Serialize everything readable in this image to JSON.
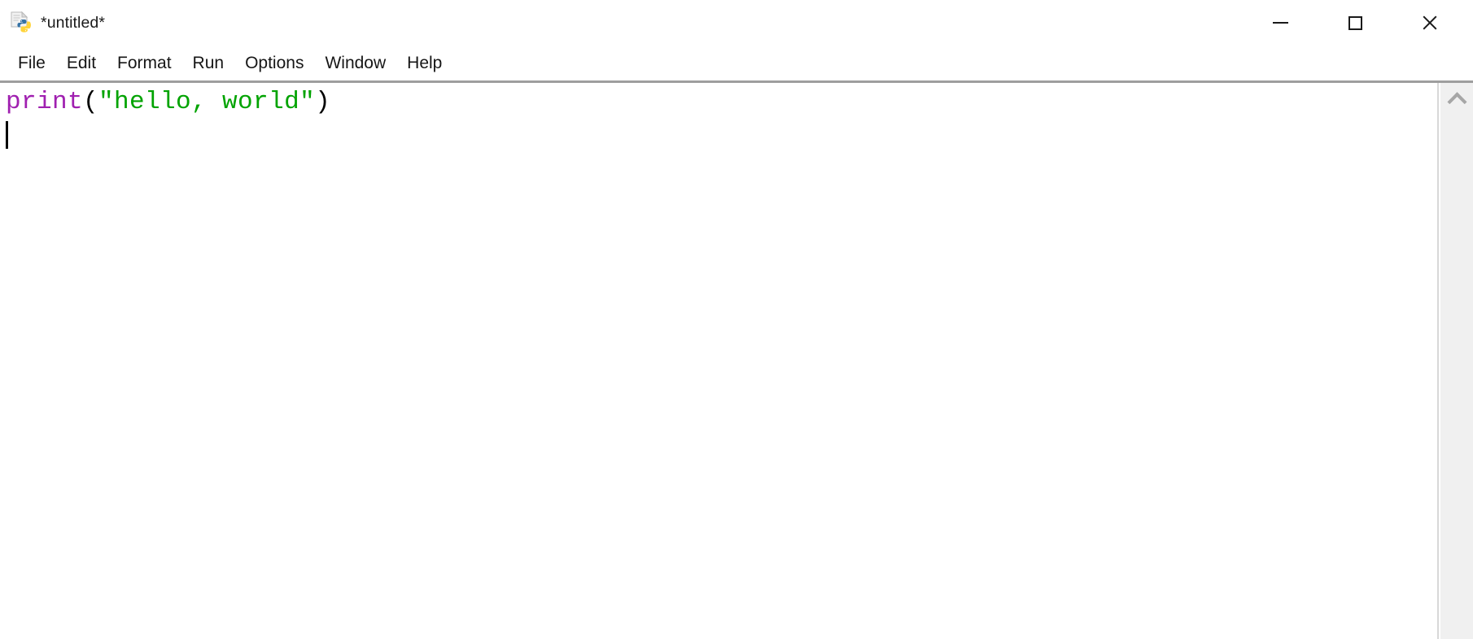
{
  "window": {
    "title": "*untitled*",
    "icon": "python-file-icon",
    "controls": {
      "minimize_label": "—",
      "maximize_label": "□",
      "close_label": "✕"
    }
  },
  "menubar": {
    "items": [
      {
        "label": "File"
      },
      {
        "label": "Edit"
      },
      {
        "label": "Format"
      },
      {
        "label": "Run"
      },
      {
        "label": "Options"
      },
      {
        "label": "Window"
      },
      {
        "label": "Help"
      }
    ]
  },
  "editor": {
    "lines": [
      {
        "tokens": [
          {
            "text": "print",
            "type": "builtin"
          },
          {
            "text": "(",
            "type": "punct"
          },
          {
            "text": "\"hello, world\"",
            "type": "string"
          },
          {
            "text": ")",
            "type": "punct"
          }
        ]
      },
      {
        "tokens": [],
        "caret": true
      }
    ],
    "full_text": "print(\"hello, world\")",
    "cursor_line": 2,
    "cursor_column": 1
  },
  "scrollbar": {
    "up_arrow": "chevron-up-icon"
  },
  "colors": {
    "builtin": "#a020b0",
    "string": "#00a300",
    "punctuation": "#000000",
    "background": "#ffffff",
    "menu_separator": "#9e9e9e",
    "scrollbar_track": "#f0f0f0",
    "scrollbar_arrow": "#a6a6a6"
  }
}
